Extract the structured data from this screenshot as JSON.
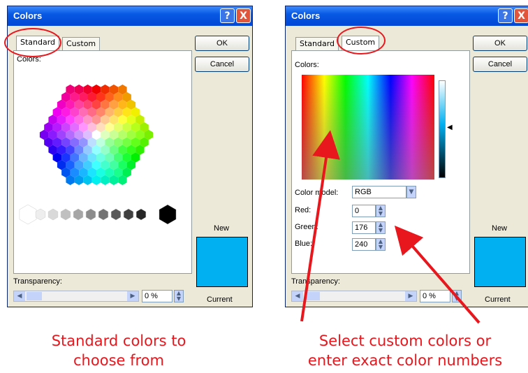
{
  "left_dialog": {
    "title": "Colors",
    "tabs": [
      "Standard",
      "Custom"
    ],
    "colors_label": "Colors:",
    "ok_label": "OK",
    "cancel_label": "Cancel",
    "new_label": "New",
    "current_label": "Current",
    "transparency_label": "Transparency:",
    "transparency_value": "0 %",
    "help_glyph": "?",
    "close_glyph": "X",
    "selected_color": "#00b0f0"
  },
  "right_dialog": {
    "title": "Colors",
    "tabs": [
      "Standard",
      "Custom"
    ],
    "colors_label": "Colors:",
    "ok_label": "OK",
    "cancel_label": "Cancel",
    "new_label": "New",
    "current_label": "Current",
    "color_model_label": "Color model:",
    "color_model_value": "RGB",
    "red_label": "Red:",
    "red_value": "0",
    "green_label": "Green:",
    "green_value": "176",
    "blue_label": "Blue:",
    "blue_value": "240",
    "transparency_label": "Transparency:",
    "transparency_value": "0 %",
    "help_glyph": "?",
    "close_glyph": "X",
    "selected_color": "#00b0f0"
  },
  "captions": {
    "left_line1": "Standard colors to",
    "left_line2": "choose from",
    "right_line1": "Select custom colors or",
    "right_line2": "enter exact color numbers"
  },
  "accent_color": "#e8171e"
}
